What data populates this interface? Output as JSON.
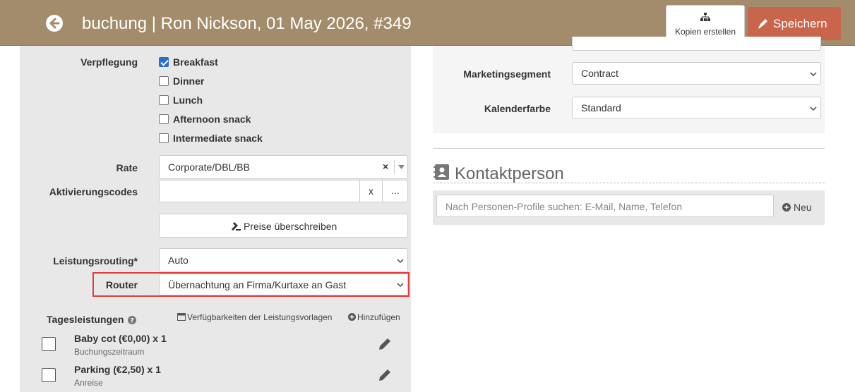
{
  "header": {
    "title": "buchung | Ron Nickson, 01 May 2026, #349",
    "copy_label": "Kopien erstellen",
    "save_label": "Speichern",
    "back_icon": "back-circle-icon",
    "copy_icon": "sitemap-icon",
    "save_icon": "pen-icon",
    "bg_color": "#a38c6b",
    "save_color": "#c8654b"
  },
  "verpflegung": {
    "label": "Verpflegung",
    "options": [
      {
        "label": "Breakfast",
        "checked": true
      },
      {
        "label": "Dinner",
        "checked": false
      },
      {
        "label": "Lunch",
        "checked": false
      },
      {
        "label": "Afternoon snack",
        "checked": false
      },
      {
        "label": "Intermediate snack",
        "checked": false
      }
    ]
  },
  "rate": {
    "label": "Rate",
    "value": "Corporate/DBL/BB",
    "clear": "×"
  },
  "activation": {
    "label": "Aktivierungscodes",
    "value": "",
    "clear": "x",
    "more": "..."
  },
  "override_button": "Preise überschreiben",
  "routing": {
    "label": "Leistungsrouting*",
    "value": "Auto"
  },
  "router": {
    "label": "Router",
    "value": "Übernachtung an Firma/Kurtaxe an Gast",
    "highlight_color": "#e03c3c"
  },
  "daily": {
    "label": "Tagesleistungen",
    "availability_link": "Verfügbarkeiten der Leistungsvorlagen",
    "add_link": "Hinzufügen",
    "items": [
      {
        "title": "Baby cot (€0,00) x 1",
        "sub": "Buchungszeitraum"
      },
      {
        "title": "Parking (€2,50) x 1",
        "sub": "Anreise"
      }
    ]
  },
  "marketing": {
    "label": "Marketingsegment",
    "value": "Contract"
  },
  "calendar": {
    "label": "Kalenderfarbe",
    "value": "Standard"
  },
  "contact": {
    "title": "Kontaktperson",
    "search_placeholder": "Nach Personen-Profile suchen: E-Mail, Name, Telefon",
    "new_label": "Neu"
  }
}
